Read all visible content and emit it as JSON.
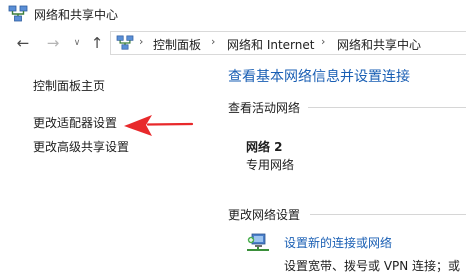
{
  "window": {
    "title": "网络和共享中心"
  },
  "navigation": {
    "back_glyph": "←",
    "forward_glyph": "→",
    "history_glyph": "∨",
    "up_glyph": "↑",
    "breadcrumbs": [
      "控制面板",
      "网络和 Internet",
      "网络和共享中心"
    ],
    "separator_glyph": "›"
  },
  "sidebar": {
    "items": [
      {
        "label": "控制面板主页"
      },
      {
        "label": "更改适配器设置"
      },
      {
        "label": "更改高级共享设置"
      }
    ]
  },
  "main": {
    "title": "查看基本网络信息并设置连接",
    "active_networks_label": "查看活动网络",
    "network": {
      "name": "网络 2",
      "type": "专用网络"
    },
    "change_settings_label": "更改网络设置",
    "new_connection": {
      "link": "设置新的连接或网络",
      "description": "设置宽带、拨号或 VPN 连接；或"
    }
  },
  "colors": {
    "link_blue": "#1a5fb4",
    "annotation_red": "#e8292b"
  },
  "icons": {
    "app": "network-center-icon",
    "location": "network-center-icon",
    "new_connection": "new-connection-icon",
    "annotation": "red-arrow"
  }
}
